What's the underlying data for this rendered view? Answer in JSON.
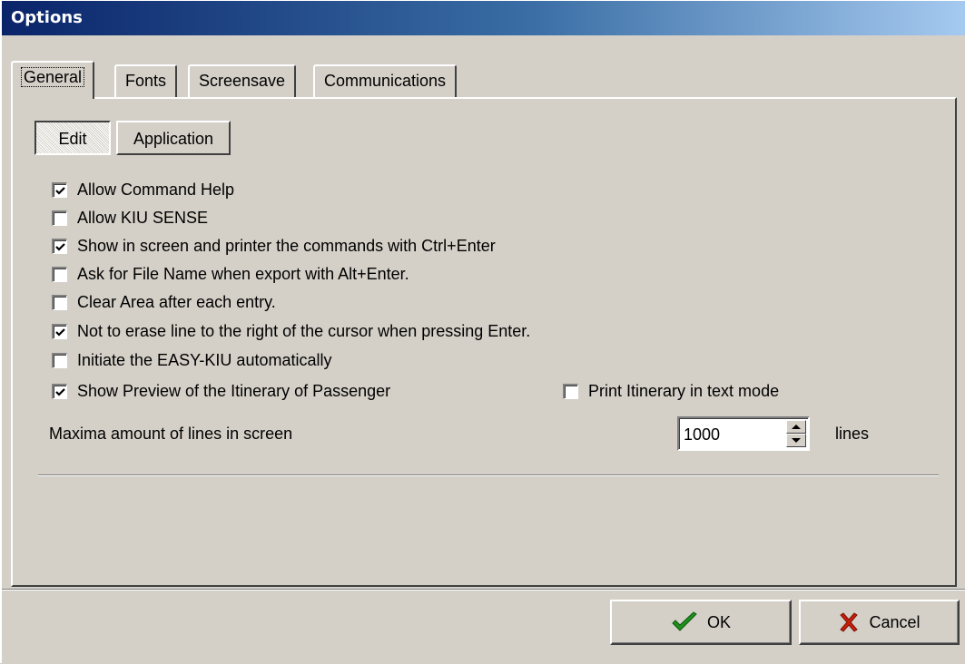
{
  "window": {
    "title": "Options"
  },
  "tabs": [
    {
      "label": "General",
      "active": true
    },
    {
      "label": "Fonts",
      "active": false
    },
    {
      "label": "Screensave",
      "active": false
    },
    {
      "label": "Communications",
      "active": false
    }
  ],
  "subtabs": [
    {
      "label": "Edit",
      "pressed": true
    },
    {
      "label": "Application",
      "pressed": false
    }
  ],
  "options": {
    "allow_command_help": {
      "label": "Allow Command Help",
      "checked": true
    },
    "allow_kiu_sense": {
      "label": "Allow KIU SENSE",
      "checked": false
    },
    "show_commands_ctrl_enter": {
      "label": "Show in screen and printer the commands with Ctrl+Enter",
      "checked": true
    },
    "ask_file_name": {
      "label": "Ask for File Name when export with Alt+Enter.",
      "checked": false
    },
    "clear_area": {
      "label": "Clear Area after each entry.",
      "checked": false
    },
    "not_erase_line": {
      "label": "Not to erase line to the right of the cursor when pressing Enter.",
      "checked": true
    },
    "initiate_easy_kiu": {
      "label": "Initiate the EASY-KIU automatically",
      "checked": false
    },
    "show_preview_itinerary": {
      "label": "Show Preview of the Itinerary of Passenger",
      "checked": true
    },
    "print_itinerary_text": {
      "label": "Print Itinerary in text mode",
      "checked": false
    }
  },
  "max_lines": {
    "label": "Maxima amount of lines in screen",
    "value": "1000",
    "unit": "lines"
  },
  "buttons": {
    "ok": {
      "label": "OK",
      "icon": "checkmark-icon",
      "color": "#1f8f1f"
    },
    "cancel": {
      "label": "Cancel",
      "icon": "x-icon",
      "color": "#c81e0a"
    }
  }
}
